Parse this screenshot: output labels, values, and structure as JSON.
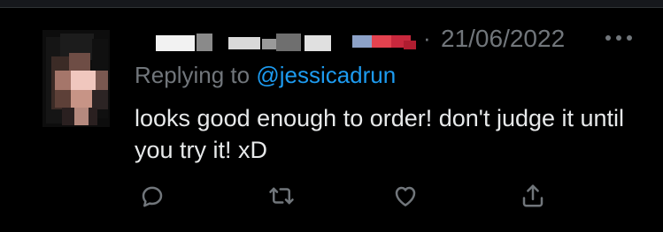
{
  "tweet": {
    "timestamp": "21/06/2022",
    "separator": "·",
    "replying_prefix": "Replying to ",
    "replying_handle": "@jessicadrun",
    "text": "looks good enough to order! don't judge it until you try it! xD"
  },
  "icons": {
    "more": "more-icon",
    "reply": "reply-icon",
    "retweet": "retweet-icon",
    "like": "like-icon",
    "share": "share-icon"
  },
  "colors": {
    "background": "#000000",
    "text_primary": "#e7e9ea",
    "text_secondary": "#71767b",
    "link": "#1d9bf0"
  }
}
